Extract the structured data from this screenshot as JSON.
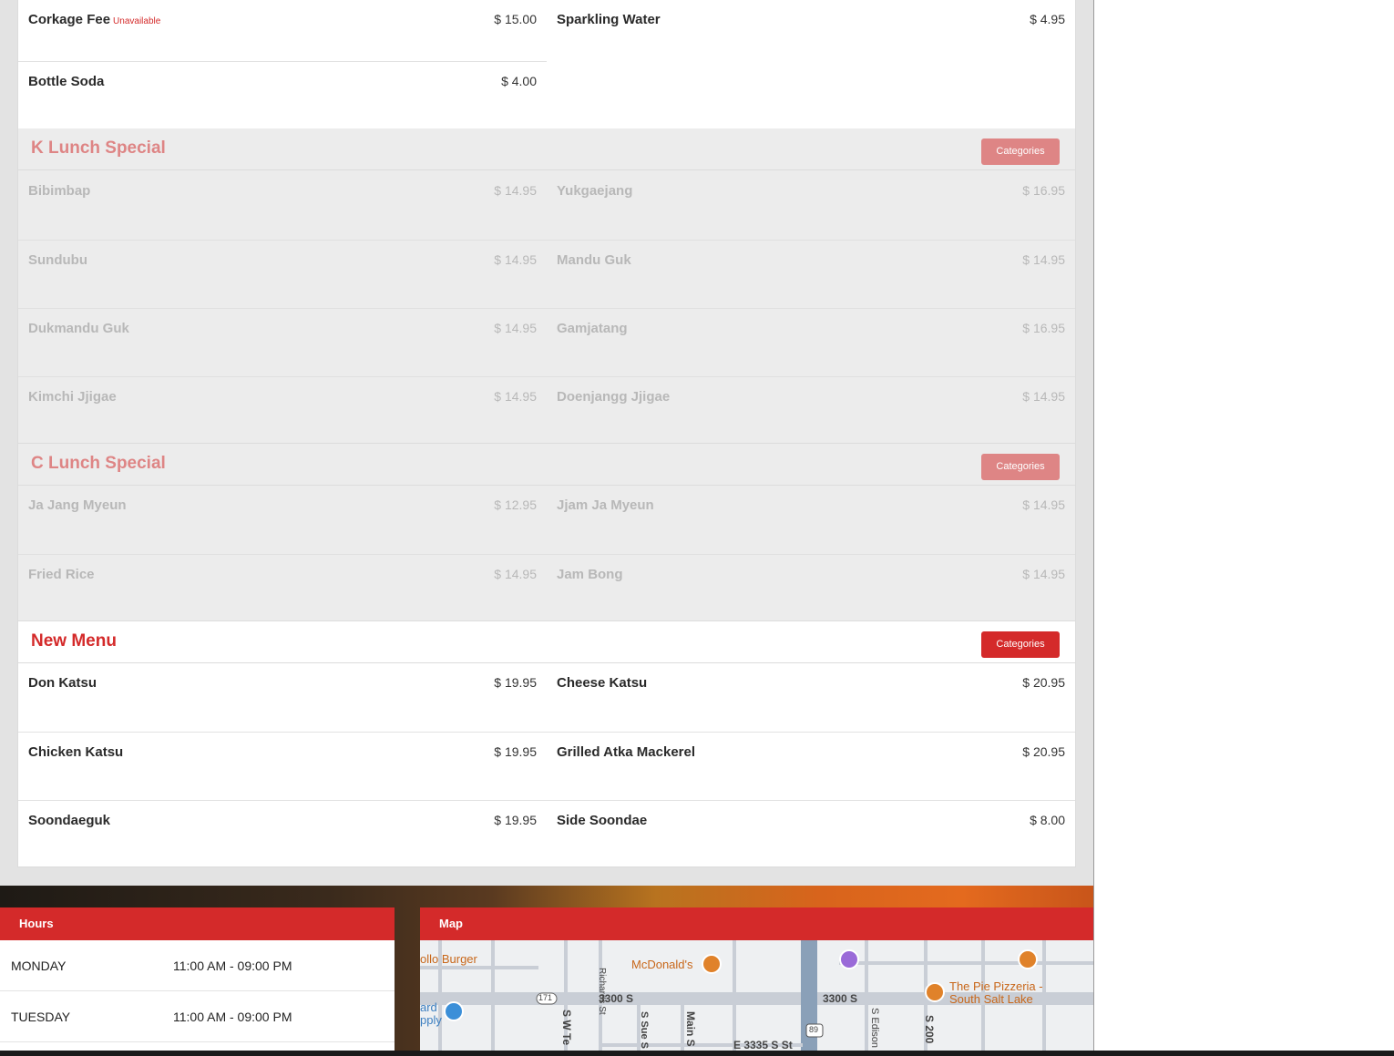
{
  "menu": {
    "top_rows": [
      {
        "left": {
          "name": "Corkage Fee",
          "badge": "Unavailable",
          "price": "$ 15.00"
        },
        "right": {
          "name": "Sparkling Water",
          "price": "$ 4.95"
        }
      },
      {
        "left": {
          "name": "Bottle Soda",
          "price": "$ 4.00"
        }
      }
    ],
    "sections": [
      {
        "title": "K Lunch Special",
        "button": "Categories",
        "available": false,
        "rows": [
          [
            {
              "name": "Bibimbap",
              "price": "$ 14.95"
            },
            {
              "name": "Yukgaejang",
              "price": "$ 16.95"
            }
          ],
          [
            {
              "name": "Sundubu",
              "price": "$ 14.95"
            },
            {
              "name": "Mandu Guk",
              "price": "$ 14.95"
            }
          ],
          [
            {
              "name": "Dukmandu Guk",
              "price": "$ 14.95"
            },
            {
              "name": "Gamjatang",
              "price": "$ 16.95"
            }
          ],
          [
            {
              "name": "Kimchi Jjigae",
              "price": "$ 14.95"
            },
            {
              "name": "Doenjangg Jjigae",
              "price": "$ 14.95"
            }
          ]
        ]
      },
      {
        "title": "C Lunch Special",
        "button": "Categories",
        "available": false,
        "rows": [
          [
            {
              "name": "Ja Jang Myeun",
              "price": "$ 12.95"
            },
            {
              "name": "Jjam Ja Myeun",
              "price": "$ 14.95"
            }
          ],
          [
            {
              "name": "Fried Rice",
              "price": "$ 14.95"
            },
            {
              "name": "Jam Bong",
              "price": "$ 14.95"
            }
          ]
        ]
      },
      {
        "title": "New Menu",
        "button": "Categories",
        "available": true,
        "rows": [
          [
            {
              "name": "Don Katsu",
              "price": "$ 19.95"
            },
            {
              "name": "Cheese Katsu",
              "price": "$ 20.95"
            }
          ],
          [
            {
              "name": "Chicken Katsu",
              "price": "$ 19.95"
            },
            {
              "name": "Grilled Atka Mackerel",
              "price": "$ 20.95"
            }
          ],
          [
            {
              "name": "Soondaeguk",
              "price": "$ 19.95"
            },
            {
              "name": "Side Soondae",
              "price": "$ 8.00"
            }
          ]
        ]
      }
    ]
  },
  "hours": {
    "title": "Hours",
    "rows": [
      {
        "day": "MONDAY",
        "time": "11:00 AM - 09:00 PM"
      },
      {
        "day": "TUESDAY",
        "time": "11:00 AM - 09:00 PM"
      }
    ]
  },
  "map": {
    "title": "Map",
    "labels": {
      "apollo": "ollo Burger",
      "mcdonalds": "McDonald's",
      "pie1": "The Pie Pizzeria -",
      "pie2": "South Salt Lake",
      "street_3300_a": "3300 S",
      "street_3300_b": "3300 S",
      "richards": "Richards St",
      "sw": "S W Te",
      "sue": "S Sue S",
      "main": "Main S",
      "edison": "S Edison",
      "s200": "S 200",
      "e3335": "E 3335 S St",
      "route171": "171",
      "route89": "89",
      "ard": "ard",
      "pply": "pply"
    }
  },
  "colors": {
    "accent": "#d42a2a",
    "accent_muted": "#de8585"
  }
}
